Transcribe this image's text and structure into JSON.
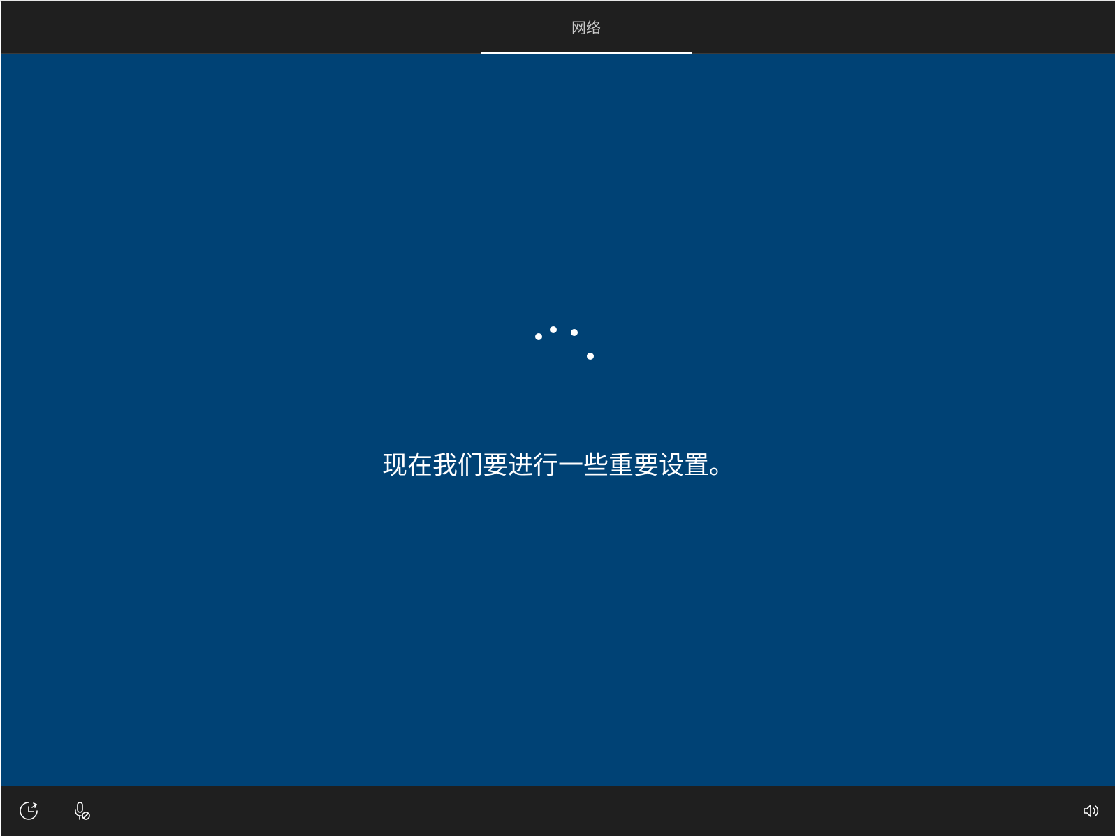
{
  "header": {
    "tab_label": "网络"
  },
  "main": {
    "message": "现在我们要进行一些重要设置。",
    "spinner_icon": "loading-dots-icon"
  },
  "footer": {
    "left_icons": [
      "ease-of-access-icon",
      "microphone-muted-icon"
    ],
    "right_icons": [
      "volume-icon"
    ]
  },
  "colors": {
    "background_blue": "#004275",
    "bar_dark": "#1f1f1f",
    "text": "#ffffff",
    "tab_text": "#c9c9c9"
  }
}
